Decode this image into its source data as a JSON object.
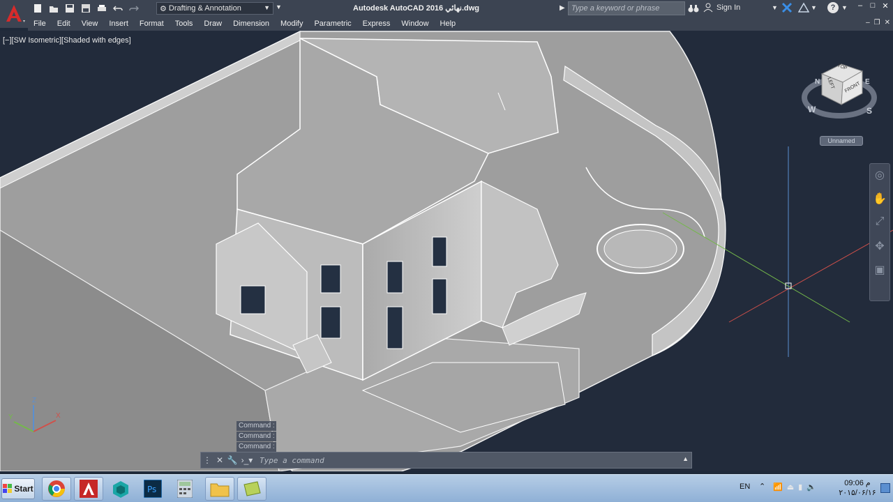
{
  "titlebar": {
    "workspace": "Drafting & Annotation",
    "title": "Autodesk AutoCAD 2016   نهائي.dwg",
    "search_placeholder": "Type a keyword or phrase",
    "signin": "Sign In"
  },
  "menu": [
    "File",
    "Edit",
    "View",
    "Insert",
    "Format",
    "Tools",
    "Draw",
    "Dimension",
    "Modify",
    "Parametric",
    "Express",
    "Window",
    "Help"
  ],
  "viewport": {
    "label": "[−][SW Isometric][Shaded with edges]",
    "viewcube": {
      "top": "TOP",
      "left": "LEFT",
      "front": "FRONT",
      "compass_w": "W",
      "compass_s": "S",
      "compass_n": "N",
      "compass_e": "E"
    },
    "ucs_name": "Unnamed",
    "axis": {
      "x": "X",
      "y": "Y",
      "z": "Z"
    }
  },
  "command": {
    "history": [
      "Command :",
      "Command :",
      "Command :"
    ],
    "placeholder": "Type a command"
  },
  "taskbar": {
    "start": "Start",
    "lang": "EN",
    "time": "09:06 م",
    "date": "۲۰۱۵/۰۶/۱۶"
  },
  "colors": {
    "background": "#222b3b",
    "ribbon": "#3c4452",
    "model": "#b7b7b7",
    "accent": "#c0392b"
  }
}
